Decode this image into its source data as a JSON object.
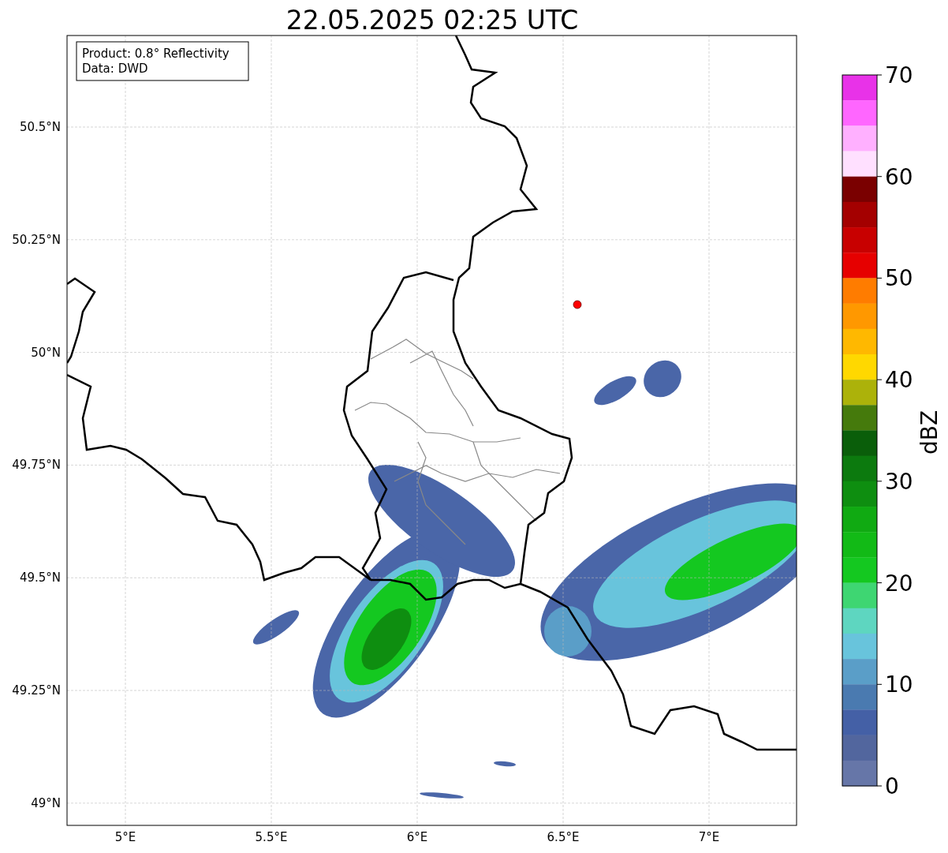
{
  "title": "22.05.2025 02:25 UTC",
  "info_box": [
    "Product: 0.8° Reflectivity",
    "Data: DWD"
  ],
  "map": {
    "x_ticks": [
      "5°E",
      "5.5°E",
      "6°E",
      "6.5°E",
      "7°E"
    ],
    "y_ticks": [
      "50.5°N",
      "50.25°N",
      "50°N",
      "49.75°N",
      "49.5°N",
      "49.25°N",
      "49°N"
    ]
  },
  "colorbar": {
    "label": "dBZ",
    "ticks": [
      "70",
      "60",
      "50",
      "40",
      "30",
      "20",
      "10",
      "0"
    ],
    "bands": [
      {
        "color": "#e832e8"
      },
      {
        "color": "#ff66ff"
      },
      {
        "color": "#ffb0ff"
      },
      {
        "color": "#ffe0ff"
      },
      {
        "color": "#7a0000"
      },
      {
        "color": "#a40000"
      },
      {
        "color": "#c80000"
      },
      {
        "color": "#e60000"
      },
      {
        "color": "#ff7c00"
      },
      {
        "color": "#ff9800"
      },
      {
        "color": "#ffb800"
      },
      {
        "color": "#ffd800"
      },
      {
        "color": "#acb20a"
      },
      {
        "color": "#457a0c"
      },
      {
        "color": "#0a5e0a"
      },
      {
        "color": "#0c7a0e"
      },
      {
        "color": "#0e8e10"
      },
      {
        "color": "#10aa12"
      },
      {
        "color": "#12ba16"
      },
      {
        "color": "#14c820"
      },
      {
        "color": "#3ed672"
      },
      {
        "color": "#5ed6c0"
      },
      {
        "color": "#68c4dc"
      },
      {
        "color": "#5a9ec8"
      },
      {
        "color": "#4a7ab0"
      },
      {
        "color": "#4460a6"
      },
      {
        "color": "#52669e"
      },
      {
        "color": "#6676a8"
      }
    ]
  }
}
